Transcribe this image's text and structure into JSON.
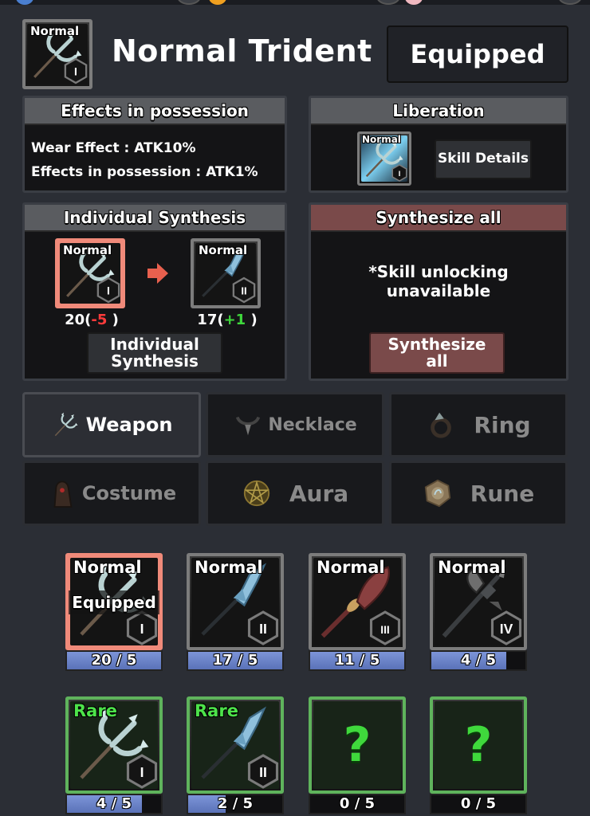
{
  "header": {
    "item_grade": "Normal",
    "item_tier": "I",
    "title": "Normal Trident",
    "equipped_label": "Equipped"
  },
  "effects_panel": {
    "title": "Effects in possession",
    "lines": [
      "Wear Effect : ATK10%",
      "Effects in possession : ATK1%"
    ]
  },
  "liberation_panel": {
    "title": "Liberation",
    "icon_grade": "Normal",
    "icon_tier": "I",
    "skill_details_label": "Skill Details"
  },
  "individual_synthesis": {
    "title": "Individual Synthesis",
    "from": {
      "grade": "Normal",
      "tier": "I",
      "count": "20(",
      "delta": "-5",
      "close": " )"
    },
    "to": {
      "grade": "Normal",
      "tier": "II",
      "count": "17(",
      "delta": "+1",
      "close": " )"
    },
    "button_label_1": "Individual",
    "button_label_2": "Synthesis"
  },
  "synthesize_all": {
    "title": "Synthesize all",
    "notice_1": "*Skill unlocking",
    "notice_2": "unavailable",
    "button_label_1": "Synthesize",
    "button_label_2": "all"
  },
  "categories": [
    {
      "label": "Weapon",
      "icon": "trident-icon",
      "active": true
    },
    {
      "label": "Necklace",
      "icon": "necklace-icon",
      "active": false
    },
    {
      "label": "Ring",
      "icon": "ring-icon",
      "active": false
    },
    {
      "label": "Costume",
      "icon": "costume-icon",
      "active": false
    },
    {
      "label": "Aura",
      "icon": "pentagram-icon",
      "active": false
    },
    {
      "label": "Rune",
      "icon": "rune-stone-icon",
      "active": false
    }
  ],
  "inventory": [
    {
      "grade": "Normal",
      "tier": "I",
      "count": "20 / 5",
      "progress": 1.0,
      "equipped": true,
      "equipped_label": "Equipped",
      "weapon": "trident"
    },
    {
      "grade": "Normal",
      "tier": "II",
      "count": "17 / 5",
      "progress": 1.0,
      "equipped": false,
      "weapon": "spear"
    },
    {
      "grade": "Normal",
      "tier": "III",
      "count": "11 / 5",
      "progress": 1.0,
      "equipped": false,
      "weapon": "glaive"
    },
    {
      "grade": "Normal",
      "tier": "IV",
      "count": "4 / 5",
      "progress": 0.8,
      "equipped": false,
      "weapon": "halberd"
    },
    {
      "grade": "Rare",
      "tier": "I",
      "count": "4 / 5",
      "progress": 0.8,
      "equipped": false,
      "weapon": "trident"
    },
    {
      "grade": "Rare",
      "tier": "II",
      "count": "2 / 5",
      "progress": 0.4,
      "equipped": false,
      "weapon": "spear"
    },
    {
      "grade": "",
      "tier": "",
      "count": "0 / 5",
      "progress": 0,
      "locked": true,
      "locked_symbol": "?"
    },
    {
      "grade": "",
      "tier": "",
      "count": "0 / 5",
      "progress": 0,
      "locked": true,
      "locked_symbol": "?"
    }
  ],
  "colors": {
    "normal_border": "#7c7c7c",
    "selected_border": "#f08a7a",
    "rare_border": "#5fb35c",
    "rare_text": "#4de34a",
    "progress_fill": "#7d95d8",
    "delta_negative": "#ff3b3b",
    "delta_positive": "#3fd83c",
    "synth_all_accent": "#7a4a4a"
  }
}
